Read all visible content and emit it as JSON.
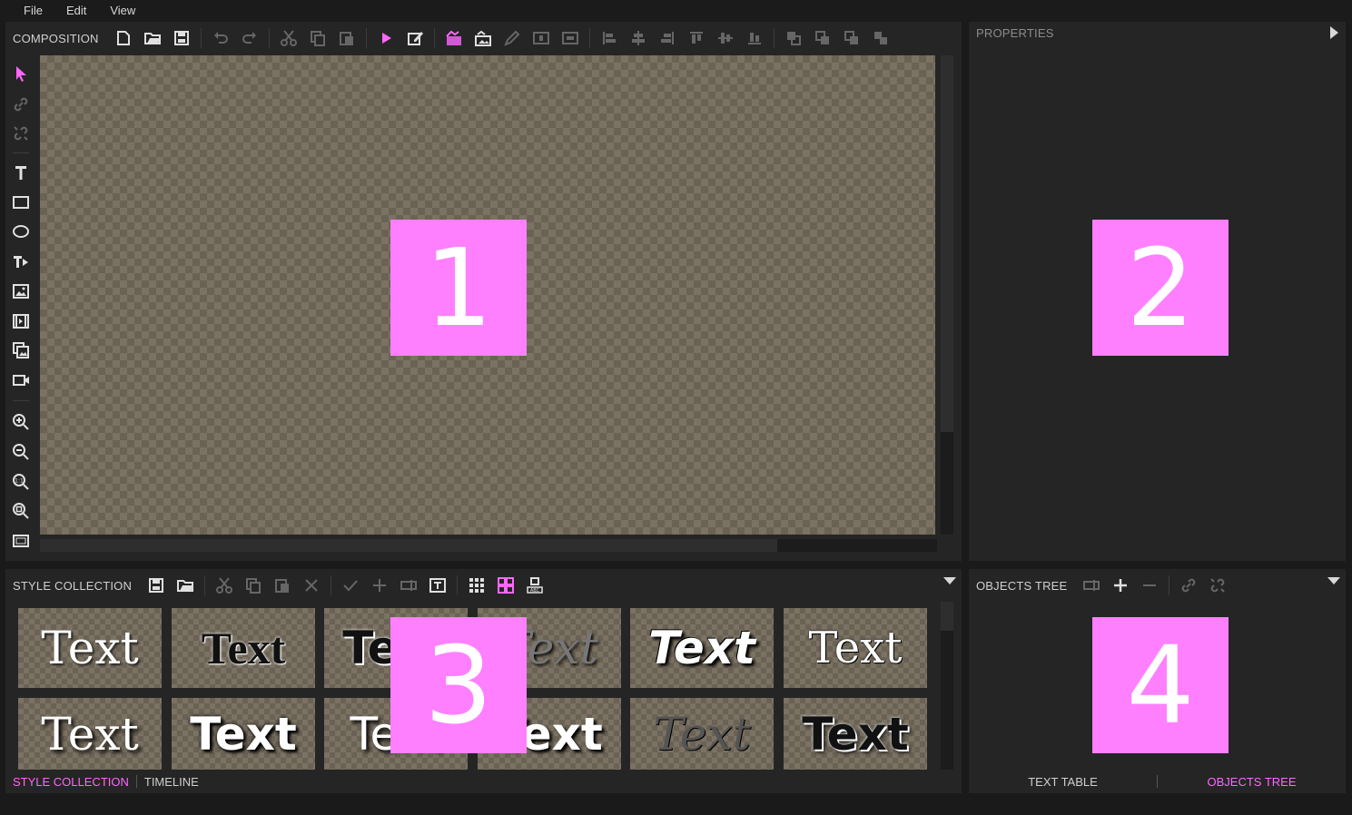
{
  "menu": {
    "file": "File",
    "edit": "Edit",
    "view": "View"
  },
  "composition": {
    "title": "COMPOSITION",
    "marker": "1"
  },
  "properties": {
    "title": "PROPERTIES",
    "marker": "2"
  },
  "style_collection": {
    "title": "STYLE COLLECTION",
    "marker": "3",
    "items": [
      "Text",
      "Text",
      "Text",
      "Text",
      "Text",
      "Text",
      "Text",
      "Text",
      "Text",
      "Text",
      "Text",
      "Text"
    ]
  },
  "objects_tree": {
    "title": "OBJECTS TREE",
    "marker": "4"
  },
  "bottom_tabs": {
    "style_collection": "STYLE COLLECTION",
    "timeline": "TIMELINE"
  },
  "tree_tabs": {
    "text_table": "TEXT TABLE",
    "objects_tree": "OBJECTS TREE"
  },
  "colors": {
    "accent": "#ff66ff",
    "marker": "#ff80ff",
    "panel": "#252525",
    "checker_light": "#7b7263",
    "checker_dark": "#6a6254"
  }
}
